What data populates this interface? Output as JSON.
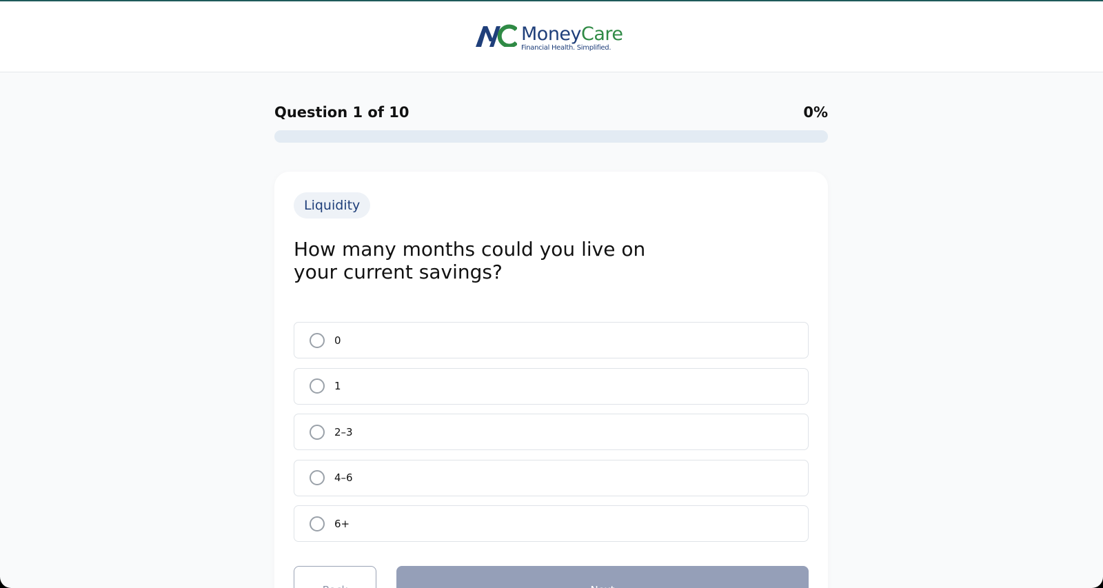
{
  "brand": {
    "name_part1": "Money",
    "name_part2": "Care",
    "tagline": "Financial Health. Simplified.",
    "colors": {
      "navy": "#1f3f7a",
      "green": "#2f8a45"
    }
  },
  "progress": {
    "label": "Question 1 of 10",
    "percent_text": "0%",
    "percent_value": 0
  },
  "question": {
    "category": "Liquidity",
    "text": "How many months could you live on your current savings?",
    "options": [
      {
        "label": "0",
        "selected": false
      },
      {
        "label": "1",
        "selected": false
      },
      {
        "label": "2–3",
        "selected": false
      },
      {
        "label": "4–6",
        "selected": false
      },
      {
        "label": "6+",
        "selected": false
      }
    ]
  },
  "nav": {
    "back_label": "Back",
    "next_label": "Next",
    "next_disabled": true
  }
}
